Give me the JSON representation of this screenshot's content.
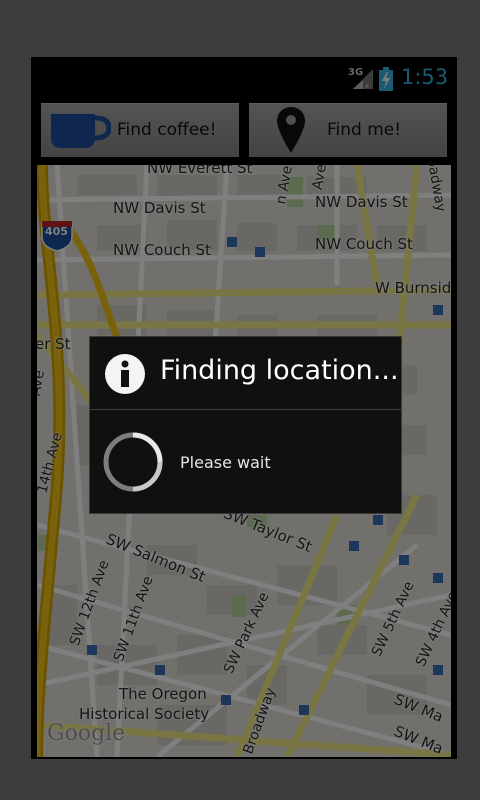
{
  "status_bar": {
    "network_type": "3G",
    "time": "1:53",
    "signal_icon": "signal-icon",
    "battery_icon": "battery-charging-icon"
  },
  "buttons": {
    "find_coffee": {
      "label": "Find coffee!",
      "icon": "coffee-cup-icon"
    },
    "find_me": {
      "label": "Find me!",
      "icon": "map-pin-icon"
    }
  },
  "map": {
    "labels": {
      "nw_everett": "NW Everett St",
      "nw_davis_1": "NW Davis St",
      "nw_davis_2": "NW Davis St",
      "nw_couch_1": "NW Couch St",
      "nw_couch_2": "NW Couch St",
      "w_burnside": "W Burnside",
      "n_ave": "n Ave",
      "ave_top": "Ave",
      "broadway_top": "oadway",
      "er_st": "er St",
      "ave_left": "Ave",
      "th14_ave": "14th Ave",
      "sw_taylor": "SW Taylor St",
      "sw_salmon": "SW Salmon St",
      "sw_12th": "SW 12th Ave",
      "sw_11th": "SW 11th Ave",
      "sw_park": "SW Park Ave",
      "sw_5th": "SW 5th Ave",
      "sw_4th": "SW 4th Ave",
      "broadway": "Broadway",
      "sw_ma": "SW Ma",
      "sw_ma_2": "SW Ma",
      "hist_1": "The Oregon",
      "hist_2": "Historical Society",
      "interstate": "405",
      "attribution": "Google"
    }
  },
  "dialog": {
    "title": "Finding location...",
    "message": "Please wait",
    "icon": "info-icon"
  },
  "colors": {
    "clock": "#35b5e5",
    "cup": "#1e4f9c",
    "highway": "#f2c94c",
    "road": "#f7ee8a",
    "map_bg": "#e8e5dc"
  }
}
